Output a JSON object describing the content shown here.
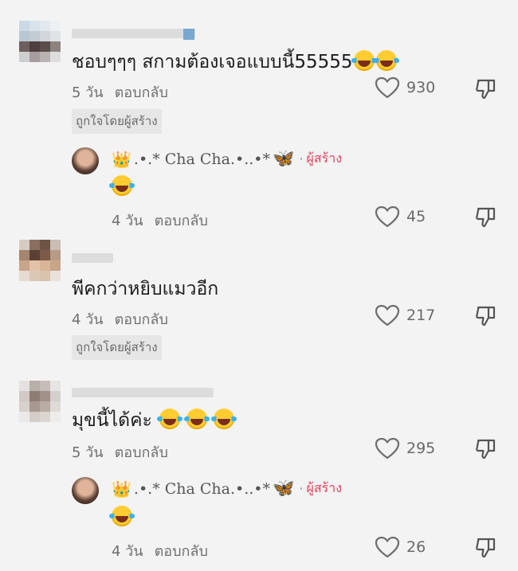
{
  "comments": [
    {
      "text": "ชอบๆๆๆ สกามต้องเจอแบบนี้55555",
      "emoji_count": 2,
      "time": "5 วัน",
      "reply_label": "ตอบกลับ",
      "likes": "930",
      "badge": "ถูกใจโดยผู้สร้าง",
      "icons": {
        "like": "heart-outline-icon",
        "dislike": "thumbs-down-icon"
      }
    },
    {
      "text": "พีคกว่าหยิบแมวอีก",
      "emoji_count": 0,
      "time": "4 วัน",
      "reply_label": "ตอบกลับ",
      "likes": "217",
      "badge": "ถูกใจโดยผู้สร้าง"
    },
    {
      "text": "มุขนี้ได้ค่ะ",
      "emoji_count": 3,
      "time": "5 วัน",
      "reply_label": "ตอบกลับ",
      "likes": "295"
    }
  ],
  "replies": [
    {
      "crown": "👑",
      "name": ".•.* Cha Cha.•..•*",
      "butterfly": "🦋",
      "separator": "·",
      "creator_label": "ผู้สร้าง",
      "time": "4 วัน",
      "reply_label": "ตอบกลับ",
      "likes": "45"
    },
    {
      "crown": "👑",
      "name": ".•.* Cha Cha.•..•*",
      "butterfly": "🦋",
      "separator": "·",
      "creator_label": "ผู้สร้าง",
      "time": "4 วัน",
      "reply_label": "ตอบกลับ",
      "likes": "26"
    }
  ],
  "colors": {
    "background": "#f3f3f3",
    "creator_label": "#e2435d",
    "meta": "#6f6f6f"
  }
}
